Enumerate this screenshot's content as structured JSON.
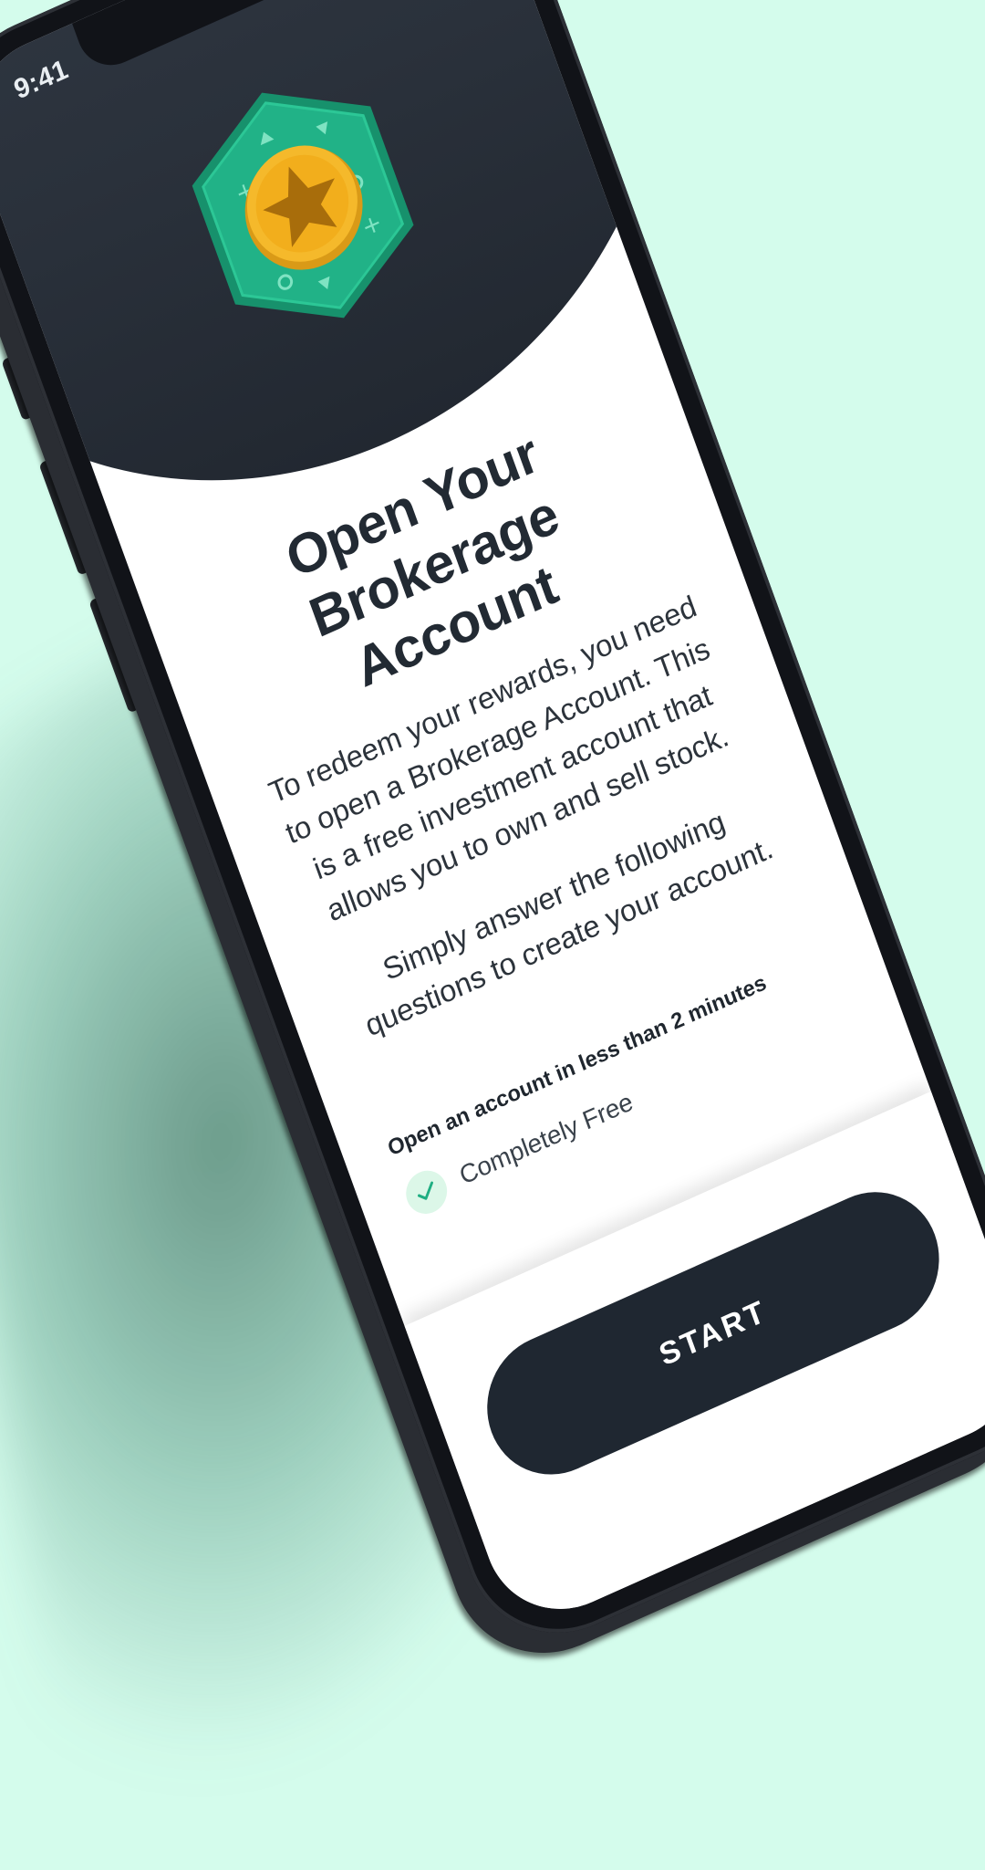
{
  "status_bar": {
    "time": "9:41"
  },
  "header": {
    "close_icon": "close-icon",
    "close_glyph": "✕",
    "badge_icon": "star-badge-icon"
  },
  "main": {
    "title": "Open Your Brokerage Account",
    "paragraphs": [
      "To redeem your rewards, you need to open a Brokerage Account. This is a free investment account that allows you to own and sell stock.",
      "Simply answer the following questions to create your account."
    ]
  },
  "features": {
    "heading": "Open an account in less than 2 minutes",
    "items": [
      {
        "label": "Completely Free",
        "icon": "check-icon"
      }
    ]
  },
  "footer": {
    "start_label": "START"
  },
  "colors": {
    "page_background": "#d4fcec",
    "header_dark": "#2a313b",
    "badge_green": "#1fae82",
    "coin_gold": "#f5b92b",
    "button_dark": "#1f2731"
  }
}
